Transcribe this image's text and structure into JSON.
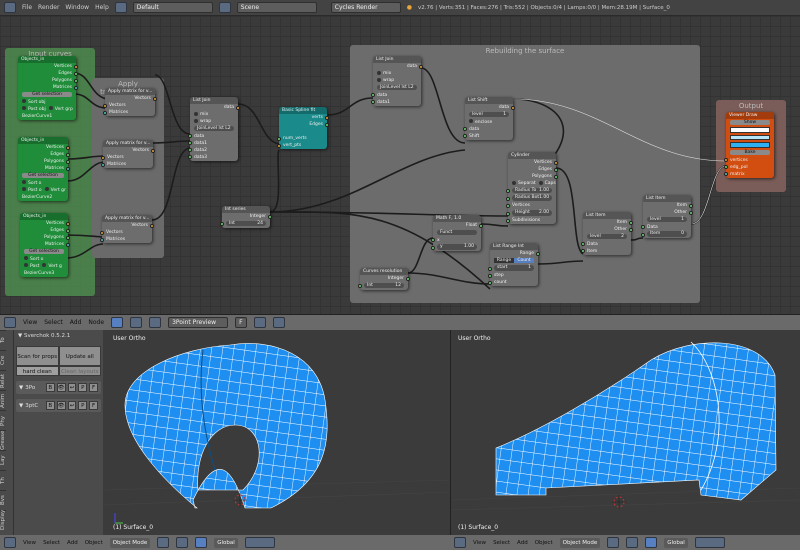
{
  "topbar": {
    "menu": [
      "File",
      "Render",
      "Window",
      "Help"
    ],
    "layout": "Default",
    "scene": "Scene",
    "engine": "Cycles Render",
    "info": "v2.76 | Verts:351 | Faces:276 | Tris:552 | Objects:0/4 | Lamps:0/0 | Mem:28.19M | Surface_0"
  },
  "frames": {
    "input": "Input curves",
    "apply": "Apply transformations",
    "rebuild": "Rebuilding the surface",
    "output": "Output"
  },
  "colors": {
    "vert": "#e8a33a",
    "gen": "#6fdc6f",
    "mat": "#4fc4c4",
    "mesh": "#1e8ff0"
  },
  "nodes": [
    {
      "id": "objin1",
      "title": "Objects_in",
      "color": "green",
      "rows": [
        {
          "t": "Vertices",
          "k": "o",
          "s": "vert"
        },
        {
          "t": "Edges",
          "k": "o"
        },
        {
          "t": "Polygons",
          "k": "o"
        },
        {
          "t": "Matrices",
          "k": "o",
          "s": "mat"
        },
        {
          "t": "Get selection",
          "k": "btn"
        },
        {
          "t": "Sort obj",
          "k": "chk"
        },
        {
          "t": "Post obj",
          "v": "Vert grp",
          "k": "chk2"
        },
        {
          "t": "BezierCurve1",
          "k": "lbl"
        }
      ]
    },
    {
      "id": "objin2",
      "title": "Objects_in",
      "color": "green",
      "rows": [
        {
          "t": "Vertices",
          "k": "o",
          "s": "vert"
        },
        {
          "t": "Edges",
          "k": "o"
        },
        {
          "t": "Polygons",
          "k": "o"
        },
        {
          "t": "Matrices",
          "k": "o",
          "s": "mat"
        },
        {
          "t": "Get selection",
          "k": "btn"
        },
        {
          "t": "Sort o",
          "k": "chk"
        },
        {
          "t": "Post o",
          "v": "Vert gr",
          "k": "chk2"
        },
        {
          "t": "BezierCurve2",
          "k": "lbl"
        }
      ]
    },
    {
      "id": "objin3",
      "title": "Objects_in",
      "color": "green",
      "rows": [
        {
          "t": "Vertices",
          "k": "o",
          "s": "vert"
        },
        {
          "t": "Edges",
          "k": "o"
        },
        {
          "t": "Polygons",
          "k": "o"
        },
        {
          "t": "Matrices",
          "k": "o",
          "s": "mat"
        },
        {
          "t": "Get selection",
          "k": "btn"
        },
        {
          "t": "Sort o",
          "k": "chk"
        },
        {
          "t": "Post",
          "v": "Vert g",
          "k": "chk2"
        },
        {
          "t": "BezierCurve3",
          "k": "lbl"
        }
      ]
    },
    {
      "id": "apply1",
      "title": "Apply matrix for v...",
      "rows": [
        {
          "t": "Vectors",
          "k": "o",
          "s": "vert"
        },
        {
          "t": "Vectors",
          "k": "i",
          "s": "vert"
        },
        {
          "t": "Matrices",
          "k": "i",
          "s": "mat"
        }
      ]
    },
    {
      "id": "apply2",
      "title": "Apply matrix for v...",
      "rows": [
        {
          "t": "Vectors",
          "k": "o",
          "s": "vert"
        },
        {
          "t": "Vectors",
          "k": "i",
          "s": "vert"
        },
        {
          "t": "Matrices",
          "k": "i",
          "s": "mat"
        }
      ]
    },
    {
      "id": "apply3",
      "title": "Apply matrix for v...",
      "rows": [
        {
          "t": "Vectors",
          "k": "o",
          "s": "vert"
        },
        {
          "t": "Vectors",
          "k": "i",
          "s": "vert"
        },
        {
          "t": "Matrices",
          "k": "i",
          "s": "mat"
        }
      ]
    },
    {
      "id": "join1",
      "title": "List Join",
      "rows": [
        {
          "t": "data",
          "k": "o",
          "s": "vert"
        },
        {
          "t": "mix",
          "k": "chk"
        },
        {
          "t": "wrap",
          "k": "chk"
        },
        {
          "t": "JoinLevel lst L2",
          "k": "fld"
        },
        {
          "t": "data",
          "k": "i"
        },
        {
          "t": "data1",
          "k": "i"
        },
        {
          "t": "data2",
          "k": "i"
        },
        {
          "t": "data3",
          "k": "i"
        }
      ]
    },
    {
      "id": "spline",
      "title": "Basic Spline fit",
      "color": "teal",
      "rows": [
        {
          "t": "verts",
          "k": "o",
          "s": "vert"
        },
        {
          "t": "Edges",
          "k": "o"
        },
        {
          "t": "",
          "k": "lbl"
        },
        {
          "t": "num_verts",
          "k": "i"
        },
        {
          "t": "vert_pts",
          "k": "i",
          "s": "vert"
        }
      ]
    },
    {
      "id": "intser",
      "title": "Int series",
      "rows": [
        {
          "t": "Integer",
          "k": "o"
        },
        {
          "t": "Int",
          "v": "24",
          "k": "fld",
          "s": "gen"
        }
      ]
    },
    {
      "id": "join2",
      "title": "List Join",
      "rows": [
        {
          "t": "data",
          "k": "o",
          "s": "vert"
        },
        {
          "t": "mix",
          "k": "chk"
        },
        {
          "t": "wrap",
          "k": "chk"
        },
        {
          "t": "JoinLevel lst L2",
          "k": "fld"
        },
        {
          "t": "data",
          "k": "i"
        },
        {
          "t": "data1",
          "k": "i"
        }
      ]
    },
    {
      "id": "shift",
      "title": "List Shift",
      "rows": [
        {
          "t": "data",
          "k": "o",
          "s": "vert"
        },
        {
          "t": "level",
          "v": "1",
          "k": "fld"
        },
        {
          "t": "enclose",
          "k": "chk"
        },
        {
          "t": "data",
          "k": "i"
        },
        {
          "t": "Shift",
          "k": "i"
        }
      ]
    },
    {
      "id": "cyl",
      "title": "Cylinder",
      "rows": [
        {
          "t": "Vertices",
          "k": "o",
          "s": "vert"
        },
        {
          "t": "Edges",
          "k": "o"
        },
        {
          "t": "Polygons",
          "k": "o"
        },
        {
          "t": "Separat",
          "v": "Caps",
          "k": "chk2"
        },
        {
          "t": "Radius To",
          "v": "1.00",
          "k": "fld",
          "s": "gen"
        },
        {
          "t": "Radius Bot",
          "v": "1.00",
          "k": "fld",
          "s": "gen"
        },
        {
          "t": "Vertices",
          "k": "i"
        },
        {
          "t": "Height",
          "v": "2.00",
          "k": "fld",
          "s": "gen"
        },
        {
          "t": "Subdivisions",
          "k": "i"
        }
      ]
    },
    {
      "id": "math",
      "title": "Math F, 1.0",
      "rows": [
        {
          "t": "Float",
          "k": "o"
        },
        {
          "t": "Funct",
          "v": "",
          "k": "fld"
        },
        {
          "t": "x",
          "k": "i"
        },
        {
          "t": "y",
          "v": "1.00",
          "k": "fld",
          "s": "gen"
        }
      ]
    },
    {
      "id": "range",
      "title": "List Range Int",
      "rows": [
        {
          "t": "Range",
          "k": "o"
        },
        {
          "t": "Range",
          "v": "Count",
          "k": "tog"
        },
        {
          "t": "start",
          "v": "1",
          "k": "fld",
          "s": "gen"
        },
        {
          "t": "step",
          "k": "i"
        },
        {
          "t": "count",
          "k": "i"
        }
      ]
    },
    {
      "id": "res",
      "title": "Curves resolution",
      "rows": [
        {
          "t": "Integer",
          "k": "o"
        },
        {
          "t": "Int",
          "v": "12",
          "k": "fld",
          "s": "gen"
        }
      ]
    },
    {
      "id": "item1",
      "title": "List Item",
      "rows": [
        {
          "t": "Item",
          "k": "o"
        },
        {
          "t": "Other",
          "k": "o"
        },
        {
          "t": "level",
          "v": "2",
          "k": "fld"
        },
        {
          "t": "Data",
          "k": "i"
        },
        {
          "t": "Item",
          "k": "i"
        }
      ]
    },
    {
      "id": "item2",
      "title": "List Item",
      "rows": [
        {
          "t": "Item",
          "k": "o"
        },
        {
          "t": "Other",
          "k": "o"
        },
        {
          "t": "level",
          "v": "1",
          "k": "fld"
        },
        {
          "t": "Data",
          "k": "i"
        },
        {
          "t": "Item",
          "v": "0",
          "k": "fld",
          "s": "gen"
        }
      ]
    },
    {
      "id": "viewer",
      "title": "Viewer Draw",
      "color": "orange",
      "rows": [
        {
          "t": "Show",
          "k": "btn"
        },
        {
          "t": "",
          "k": "sw",
          "v": "#ffffff"
        },
        {
          "t": "",
          "k": "sw",
          "v": "#b8e4f8"
        },
        {
          "t": "",
          "k": "sw",
          "v": "#2fb0f0"
        },
        {
          "t": "Bake",
          "k": "btn"
        },
        {
          "t": "vertices",
          "k": "i",
          "s": "vert"
        },
        {
          "t": "edg_pol",
          "k": "i"
        },
        {
          "t": "matrix",
          "k": "i",
          "s": "mat"
        }
      ]
    }
  ],
  "nodeheader": {
    "menu": [
      "View",
      "Select",
      "Add",
      "Node"
    ],
    "tree": "3Point Preview",
    "fake": "F"
  },
  "sverchok": {
    "title": "▼ Sverchok 0.5.2.1",
    "scan": "Scan for props",
    "update": "Update all",
    "hard": "hard clean",
    "clean": "Clean layouts",
    "trees": [
      {
        "name": "3Po",
        "b": "B",
        "p": "P",
        "f": "F"
      },
      {
        "name": "3ptC",
        "b": "B",
        "p": "P",
        "f": "F"
      }
    ],
    "tabs": [
      "To",
      "Cre",
      "Relat",
      "Anim",
      "Phy",
      "Grease",
      "Lay",
      "Th",
      "Bvs",
      "Display"
    ]
  },
  "viewports": [
    {
      "view": "User Ortho",
      "object": "(1) Surface_0"
    },
    {
      "view": "User Ortho",
      "object": "(1) Surface_0"
    }
  ],
  "bottom": {
    "menu": [
      "View",
      "Select",
      "Add",
      "Object"
    ],
    "mode": "Object Mode",
    "orientation": "Global"
  }
}
